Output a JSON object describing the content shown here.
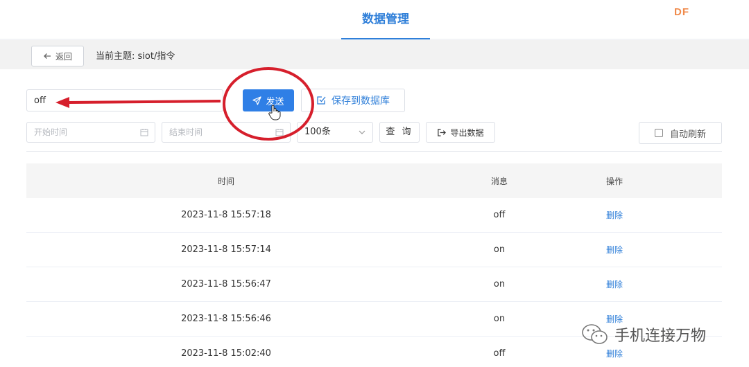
{
  "header": {
    "title": "数据管理",
    "logo_text": "DF"
  },
  "subbar": {
    "back_label": "返回",
    "topic_label": "当前主题: siot/指令"
  },
  "send_form": {
    "message_value": "off",
    "send_label": "发送",
    "save_label": "保存到数据库"
  },
  "filters": {
    "start_placeholder": "开始时间",
    "end_placeholder": "结束时间",
    "count_value": "100条",
    "query_label": "查 询",
    "export_label": "导出数据",
    "auto_refresh_label": "自动刷新"
  },
  "table": {
    "columns": [
      "时间",
      "消息",
      "操作"
    ],
    "rows": [
      {
        "time": "2023-11-8 15:57:18",
        "message": "off",
        "action": "删除"
      },
      {
        "time": "2023-11-8 15:57:14",
        "message": "on",
        "action": "删除"
      },
      {
        "time": "2023-11-8 15:56:47",
        "message": "on",
        "action": "删除"
      },
      {
        "time": "2023-11-8 15:56:46",
        "message": "on",
        "action": "删除"
      },
      {
        "time": "2023-11-8 15:02:40",
        "message": "off",
        "action": "删除"
      }
    ]
  },
  "watermark": {
    "text": "手机连接万物"
  },
  "colors": {
    "accent": "#2f7fe6",
    "annotation": "#d61f2c",
    "logo": "#f08a4b"
  }
}
